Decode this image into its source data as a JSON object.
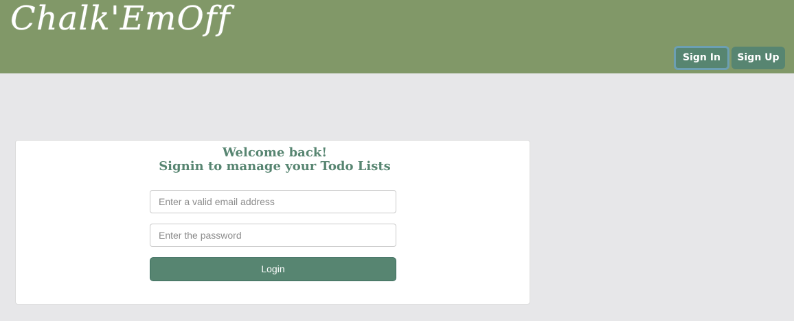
{
  "header": {
    "brand": "Chalk'EmOff",
    "nav": {
      "signin_label": "Sign In",
      "signup_label": "Sign Up"
    }
  },
  "login_card": {
    "title": "Welcome back!",
    "subtitle": "Signin to manage your Todo Lists",
    "email": {
      "placeholder": "Enter a valid email address",
      "value": ""
    },
    "password": {
      "placeholder": "Enter the password",
      "value": ""
    },
    "login_label": "Login"
  },
  "colors": {
    "header_background": "#819868",
    "accent": "#578571",
    "page_background": "#e7e7e9",
    "active_outline": "#6c9fb2"
  }
}
